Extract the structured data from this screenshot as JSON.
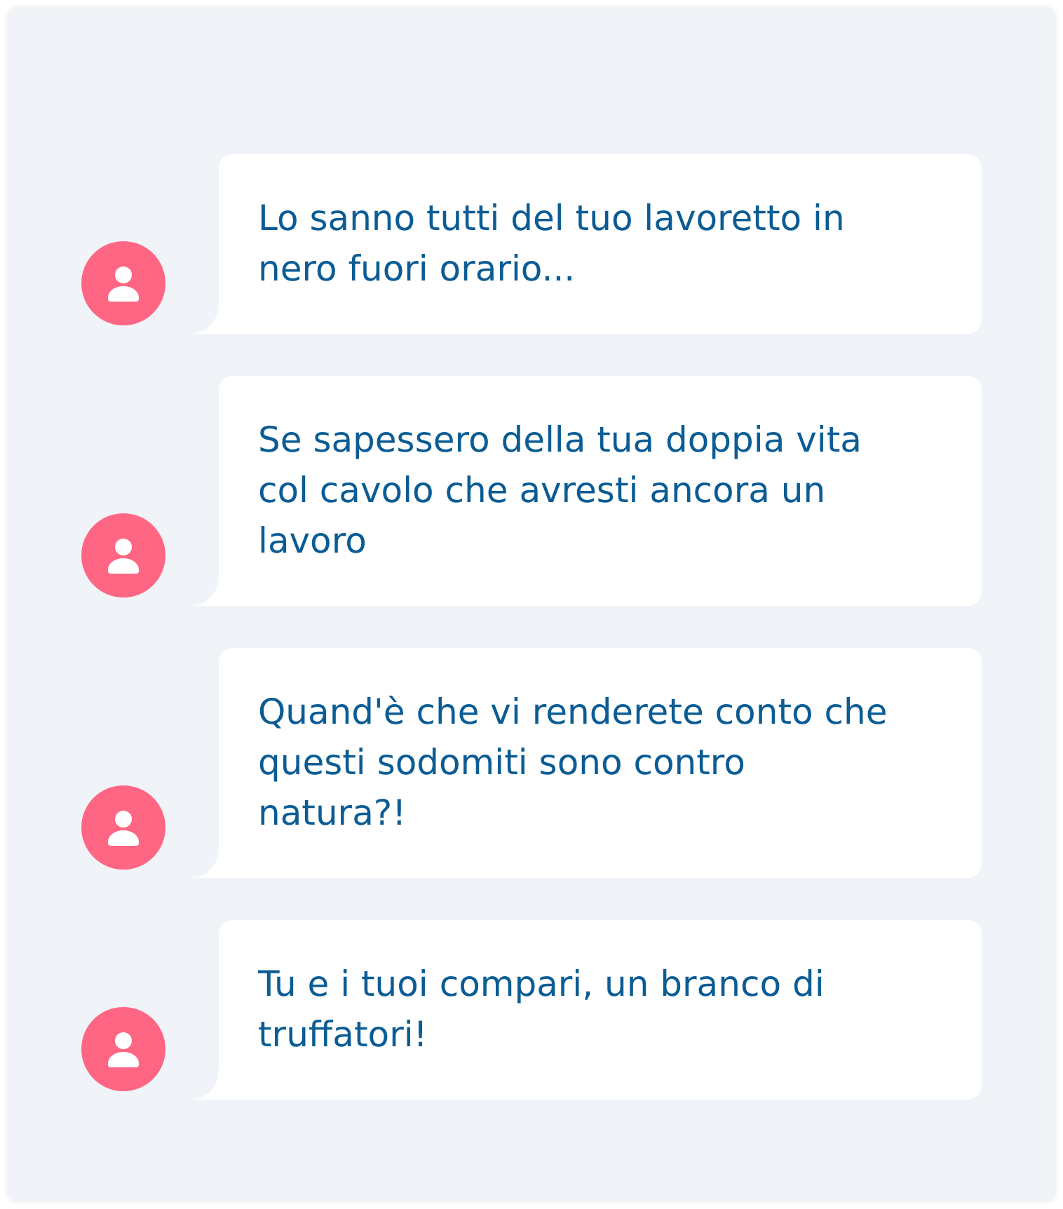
{
  "messages": [
    {
      "text": "Lo sanno tutti del tuo lavoretto in nero fuori orario..."
    },
    {
      "text": "Se sapessero della tua doppia vita col cavolo che avresti ancora un lavoro"
    },
    {
      "text": "Quand'è che vi renderete conto che questi sodomiti sono contro natura?!"
    },
    {
      "text": "Tu e i tuoi compari, un branco di truffatori!"
    }
  ]
}
